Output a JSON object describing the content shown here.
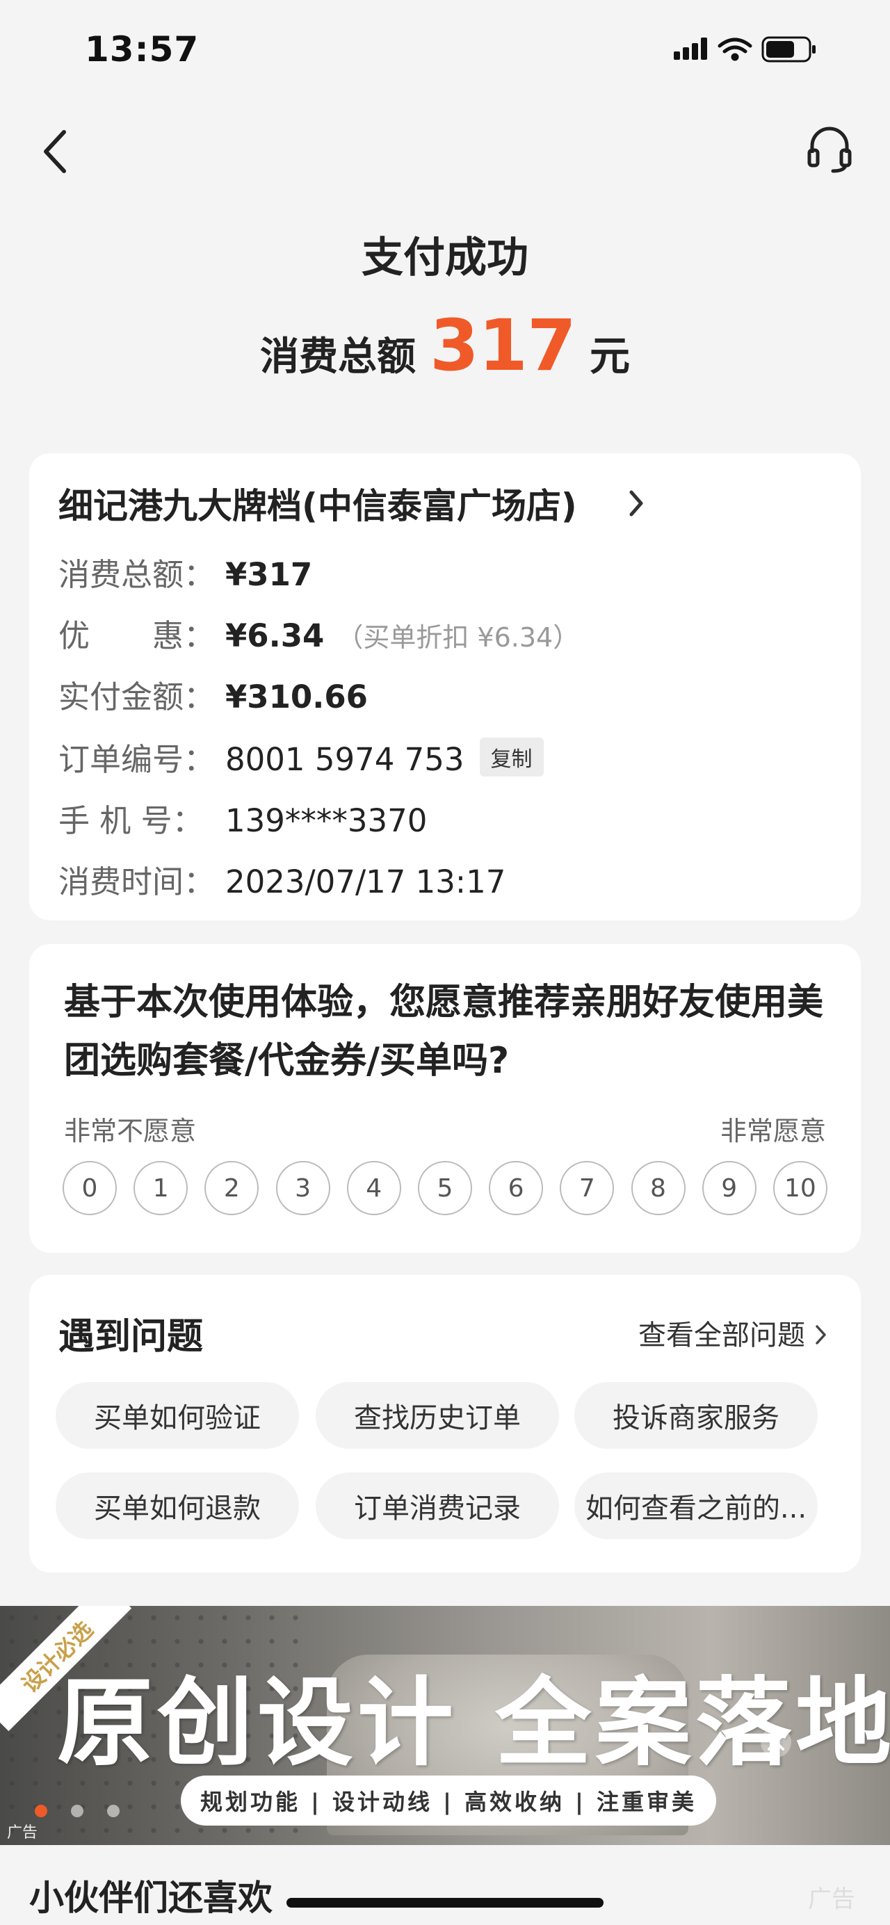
{
  "status_bar": {
    "time": "13:57"
  },
  "header": {
    "title": "支付成功",
    "total_label": "消费总额",
    "total_amount": "317",
    "total_unit": "元"
  },
  "order": {
    "store_name": "细记港九大牌档(中信泰富广场店)",
    "rows": [
      {
        "label": "消费总额：",
        "value": "¥317"
      },
      {
        "label": "优　　惠：",
        "value": "¥6.34",
        "note": "（买单折扣 ¥6.34）"
      },
      {
        "label": "实付金额：",
        "value": "¥310.66"
      },
      {
        "label": "订单编号：",
        "value": "8001 5974 753",
        "action": "复制"
      },
      {
        "label": "手 机 号：",
        "value": "139****3370"
      },
      {
        "label": "消费时间：",
        "value": "2023/07/17 13:17"
      }
    ]
  },
  "survey": {
    "question": "基于本次使用体验，您愿意推荐亲朋好友使用美团选购套餐/代金券/买单吗?",
    "low_label": "非常不愿意",
    "high_label": "非常愿意",
    "scale": [
      "0",
      "1",
      "2",
      "3",
      "4",
      "5",
      "6",
      "7",
      "8",
      "9",
      "10"
    ]
  },
  "issues": {
    "title": "遇到问题",
    "view_all": "查看全部问题",
    "chips": [
      "买单如何验证",
      "查找历史订单",
      "投诉商家服务",
      "买单如何退款",
      "订单消费记录",
      "如何查看之前的..."
    ]
  },
  "ad": {
    "ribbon": "设计必选",
    "headline": "原创设计 全案落地",
    "subline": "规划功能 | 设计动线 | 高效收纳 | 注重审美",
    "label": "广告"
  },
  "recommend": {
    "title": "小伙伴们还喜欢",
    "ad_label": "广告"
  },
  "colors": {
    "accent": "#f05a28",
    "background": "#f4f4f4",
    "card": "#ffffff"
  }
}
